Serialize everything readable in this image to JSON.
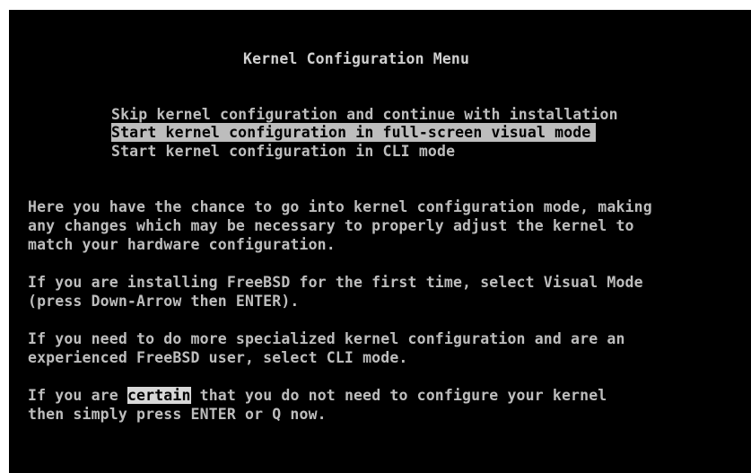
{
  "screen": {
    "title": "Kernel Configuration Menu",
    "menu": [
      {
        "label": "Skip kernel configuration and continue with installation",
        "selected": false
      },
      {
        "label": "Start kernel configuration in full-screen visual mode",
        "selected": true
      },
      {
        "label": "Start kernel configuration in CLI mode",
        "selected": false
      }
    ],
    "paragraphs": {
      "intro": [
        "Here you have the chance to go into kernel configuration mode, making",
        "any changes which may be necessary to properly adjust the kernel to",
        "match your hardware configuration."
      ],
      "first_time": [
        "If you are installing FreeBSD for the first time, select Visual Mode",
        "(press Down-Arrow then ENTER)."
      ],
      "specialized": [
        "If you need to do more specialized kernel configuration and are an",
        "experienced FreeBSD user, select CLI mode."
      ],
      "certain": {
        "line1_prefix": "If you are ",
        "line1_highlight": "certain",
        "line1_suffix": " that you do not need to configure your kernel",
        "line2": "then simply press ENTER or Q now."
      }
    },
    "colors": {
      "background": "#000000",
      "text": "#bdbdbd",
      "selection": "#bdbdbd"
    }
  }
}
